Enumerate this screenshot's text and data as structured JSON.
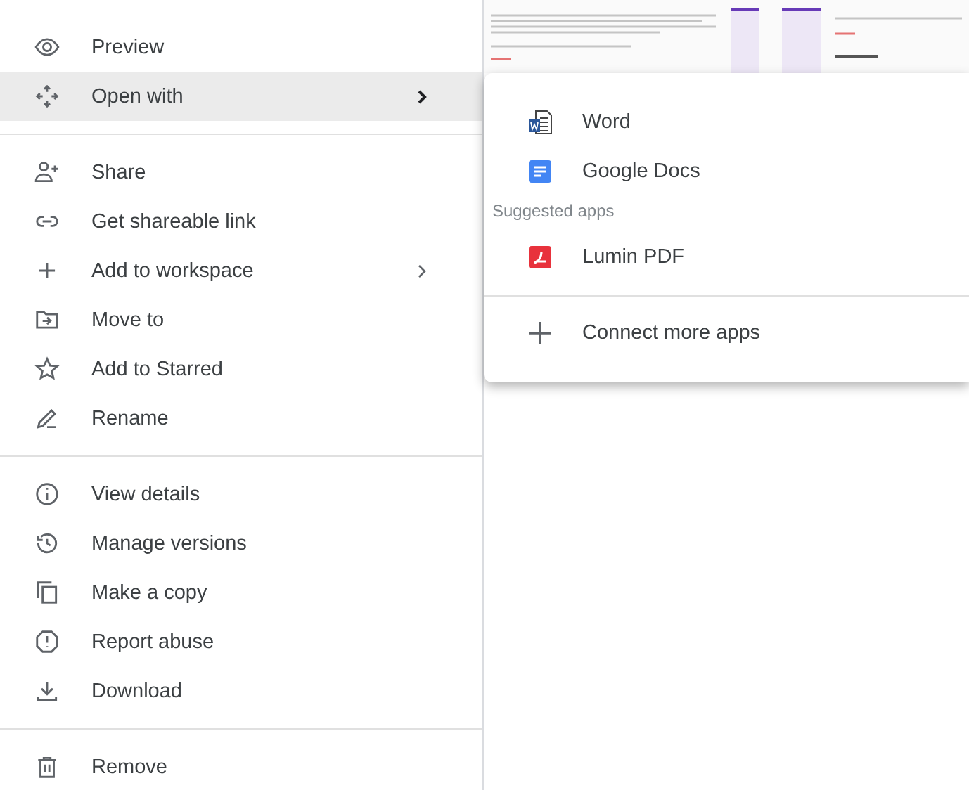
{
  "menu": {
    "sections": [
      {
        "items": [
          {
            "label": "Preview",
            "selected": false,
            "has_submenu": false
          },
          {
            "label": "Open with",
            "selected": true,
            "has_submenu": true
          }
        ]
      },
      {
        "items": [
          {
            "label": "Share",
            "selected": false,
            "has_submenu": false
          },
          {
            "label": "Get shareable link",
            "selected": false,
            "has_submenu": false
          },
          {
            "label": "Add to workspace",
            "selected": false,
            "has_submenu": true
          },
          {
            "label": "Move to",
            "selected": false,
            "has_submenu": false
          },
          {
            "label": "Add to Starred",
            "selected": false,
            "has_submenu": false
          },
          {
            "label": "Rename",
            "selected": false,
            "has_submenu": false
          }
        ]
      },
      {
        "items": [
          {
            "label": "View details",
            "selected": false,
            "has_submenu": false
          },
          {
            "label": "Manage versions",
            "selected": false,
            "has_submenu": false
          },
          {
            "label": "Make a copy",
            "selected": false,
            "has_submenu": false
          },
          {
            "label": "Report abuse",
            "selected": false,
            "has_submenu": false
          },
          {
            "label": "Download",
            "selected": false,
            "has_submenu": false
          }
        ]
      },
      {
        "items": [
          {
            "label": "Remove",
            "selected": false,
            "has_submenu": false
          }
        ]
      }
    ]
  },
  "submenu": {
    "apps": [
      {
        "label": "Word",
        "kind": "word"
      },
      {
        "label": "Google Docs",
        "kind": "docs"
      }
    ],
    "suggested_heading": "Suggested apps",
    "suggested_apps": [
      {
        "label": "Lumin PDF",
        "kind": "pdf"
      }
    ],
    "connect": "Connect more apps"
  }
}
